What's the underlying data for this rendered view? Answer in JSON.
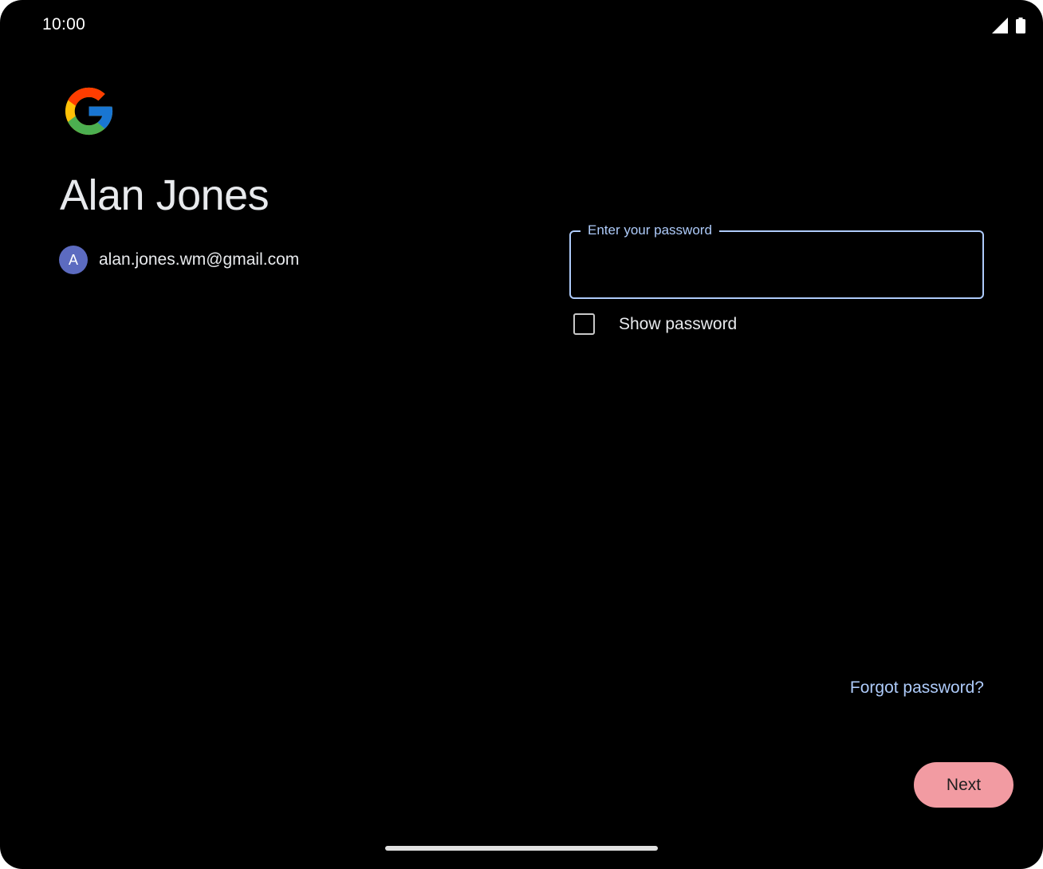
{
  "status_bar": {
    "time": "10:00",
    "icons": [
      "signal-icon",
      "battery-icon"
    ]
  },
  "logo": "google-g-logo",
  "account": {
    "name": "Alan Jones",
    "avatar_initial": "A",
    "email": "alan.jones.wm@gmail.com"
  },
  "password": {
    "label": "Enter your password",
    "value": ""
  },
  "show_password": {
    "label": "Show password",
    "checked": false
  },
  "forgot_password": {
    "label": "Forgot password?"
  },
  "next": {
    "label": "Next"
  },
  "colors": {
    "background": "#000000",
    "accent": "#aecbfa",
    "next_button": "#f29ba2",
    "avatar": "#5c6bc0"
  }
}
